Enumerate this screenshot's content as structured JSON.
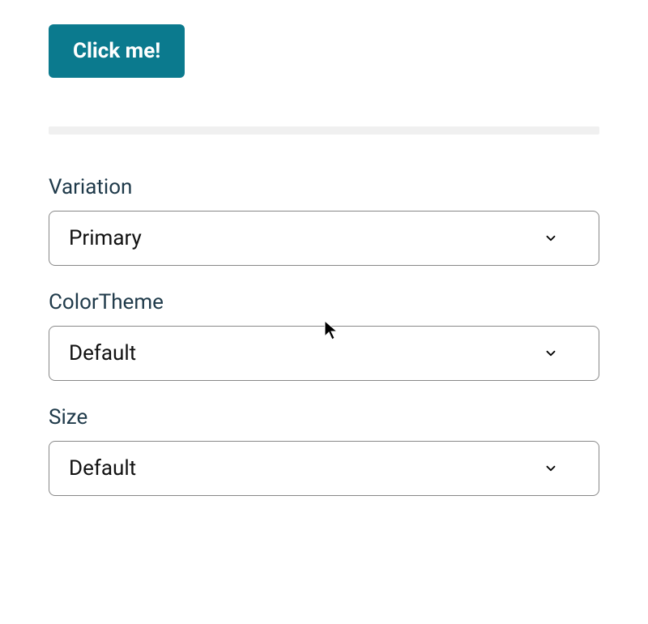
{
  "demo": {
    "button_label": "Click me!"
  },
  "controls": [
    {
      "label": "Variation",
      "value": "Primary"
    },
    {
      "label": "ColorTheme",
      "value": "Default"
    },
    {
      "label": "Size",
      "value": "Default"
    }
  ],
  "colors": {
    "accent": "#0b7a8e"
  }
}
